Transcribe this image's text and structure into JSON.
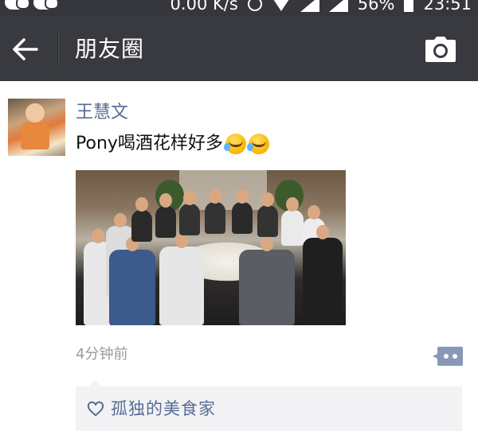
{
  "status_bar": {
    "speed": "0.00 K/s",
    "battery": "56%",
    "time": "23:51",
    "icons": [
      "wechat-icon",
      "wechat-icon",
      "clock-icon",
      "wifi-icon",
      "signal-icon",
      "signal-icon",
      "battery-icon"
    ]
  },
  "title_bar": {
    "title": "朋友圈",
    "back_icon": "arrow-left-icon",
    "camera_icon": "camera-icon"
  },
  "post": {
    "author": "王慧文",
    "text": "Pony喝酒花样好多",
    "emojis": [
      "laughing-crying-emoji",
      "laughing-crying-emoji"
    ],
    "time": "4分钟前",
    "comment_icon": "comment-dots-icon"
  },
  "likes": {
    "icon": "heart-outline-icon",
    "names": "孤独的美食家"
  },
  "colors": {
    "title_bar_bg": "#393a3f",
    "link_blue": "#576b95",
    "likes_bg": "#f3f3f5",
    "time_gray": "#9b9b9b"
  }
}
